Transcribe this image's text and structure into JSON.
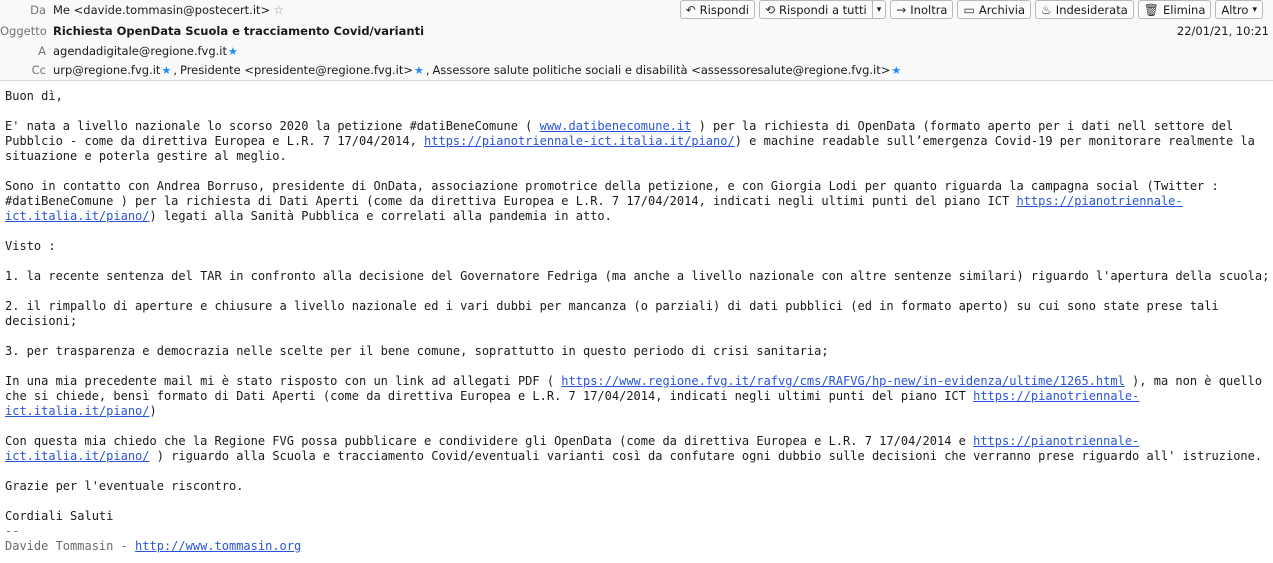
{
  "header": {
    "from_label": "Da",
    "from_value": "Me <davide.tommasin@postecert.it>",
    "subject_label": "Oggetto",
    "subject_value": "Richiesta OpenData Scuola e tracciamento Covid/varianti",
    "to_label": "A",
    "to_value": "agendadigitale@regione.fvg.it",
    "cc_label": "Cc",
    "cc_1": "urp@regione.fvg.it",
    "cc_2": "Presidente <presidente@regione.fvg.it>",
    "cc_3": "Assessore salute politiche sociali e disabilità <assessoresalute@regione.fvg.it>",
    "comma": ",",
    "date": "22/01/21, 10:21"
  },
  "toolbar": {
    "reply": "Rispondi",
    "reply_all": "Rispondi a tutti",
    "forward": "Inoltra",
    "archive": "Archivia",
    "junk": "Indesiderata",
    "delete": "Elimina",
    "more": "Altro"
  },
  "body": {
    "greeting": "Buon dì,",
    "p1_a": "E' nata a livello nazionale lo scorso 2020 la petizione #datiBeneComune ( ",
    "p1_link1": "www.datibenecomune.it",
    "p1_b": " ) per la richiesta di OpenData (formato aperto per i dati nell settore del Pubblcio - come da direttiva Europea e L.R. 7 17/04/2014, ",
    "p1_link2": "https://pianotriennale-ict.italia.it/piano/",
    "p1_c": ") e machine readable sull’emergenza Covid-19 per monitorare realmente la situazione e poterla gestire al meglio.",
    "p2_a": "Sono in contatto con Andrea Borruso, presidente di OnData, associazione promotrice della petizione, e con Giorgia Lodi per quanto riguarda la campagna social (Twitter : #datiBeneComune ) per la richiesta di Dati Aperti (come da direttiva Europea e L.R. 7 17/04/2014, indicati negli ultimi punti del piano ICT ",
    "p2_link": "https://pianotriennale-ict.italia.it/piano/",
    "p2_b": ") legati alla Sanità Pubblica e correlati alla pandemia in atto.",
    "visto": "Visto :",
    "item1": "1. la recente sentenza del TAR in confronto alla decisione del Governatore Fedriga (ma anche a livello nazionale con altre sentenze similari) riguardo l'apertura della scuola;",
    "item2": "2. il rimpallo di aperture e chiusure a livello nazionale ed i vari dubbi per mancanza (o parziali) di dati pubblici (ed in formato aperto) su cui sono state prese tali decisioni;",
    "item3": "3. per trasparenza e democrazia nelle scelte per il bene comune, soprattutto in questo periodo di crisi sanitaria;",
    "p3_a": "In una mia precedente mail mi è stato risposto con un link ad allegati PDF ( ",
    "p3_link1": "https://www.regione.fvg.it/rafvg/cms/RAFVG/hp-new/in-evidenza/ultime/1265.html",
    "p3_b": " ), ma non è quello che si chiede, bensì formato di Dati Aperti (come da direttiva Europea e L.R. 7 17/04/2014, indicati negli ultimi punti del piano ICT ",
    "p3_link2": "https://pianotriennale-ict.italia.it/piano/",
    "p3_c": ")",
    "p4_a": "Con questa mia chiedo che la Regione FVG possa pubblicare e condividere gli OpenData (come da direttiva Europea e L.R. 7 17/04/2014 e ",
    "p4_link": "https://pianotriennale-ict.italia.it/piano/",
    "p4_b": " ) riguardo alla Scuola e tracciamento Covid/eventuali varianti così da confutare ogni dubbio sulle decisioni che verranno prese riguardo all' istruzione.",
    "thanks": "Grazie per l'eventuale riscontro.",
    "closing": "Cordiali Saluti",
    "sig_sep": "--",
    "sig_name": "Davide Tommasin - ",
    "sig_link": "http://www.tommasin.org"
  }
}
